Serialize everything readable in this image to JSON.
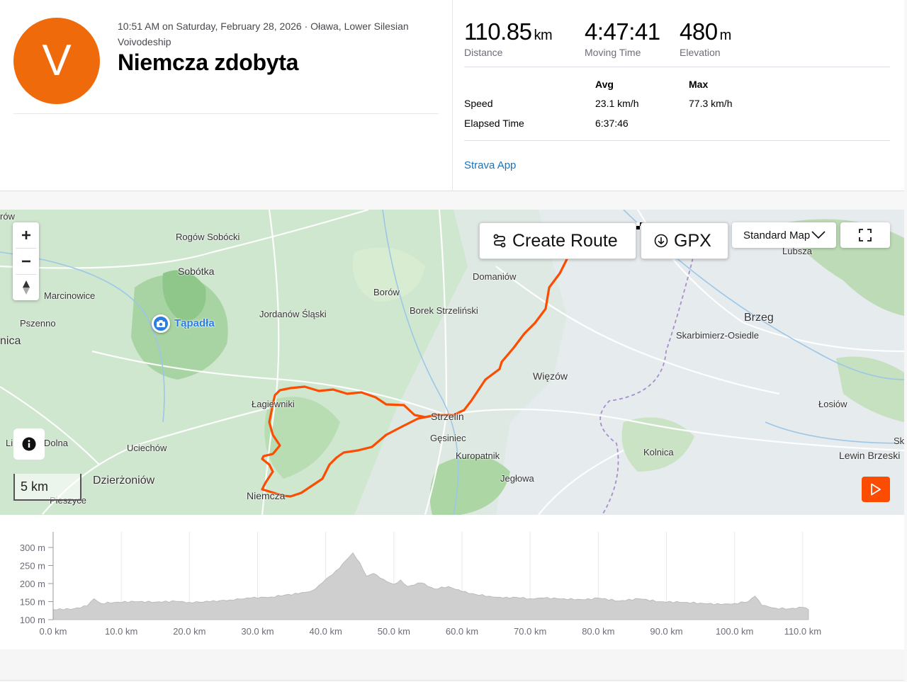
{
  "activity": {
    "avatar_letter": "V",
    "avatar_color": "#EF6A0B",
    "meta": "10:51 AM on Saturday, February 28, 2026 · Oława, Lower Silesian Voivodeship",
    "title": "Niemcza zdobyta"
  },
  "stats": {
    "distance": {
      "value": "110.85",
      "unit": "km",
      "label": "Distance"
    },
    "moving_time": {
      "value": "4:47:41",
      "label": "Moving Time"
    },
    "elevation": {
      "value": "480",
      "unit": "m",
      "label": "Elevation"
    }
  },
  "details": {
    "col_avg": "Avg",
    "col_max": "Max",
    "rows": [
      {
        "label": "Speed",
        "avg": "23.1 km/h",
        "max": "77.3 km/h"
      },
      {
        "label": "Elapsed Time",
        "avg": "6:37:46",
        "max": ""
      }
    ]
  },
  "device": "Strava App",
  "map": {
    "controls": {
      "create_route": "Create Route",
      "gpx": "GPX",
      "map_type": "Standard Map",
      "scale": "5 km",
      "photo_label": "Tąpadła"
    },
    "places": {
      "row": "rów",
      "rogow": "Rogów Sobócki",
      "sobotka": "Sobótka",
      "marcinowice": "Marcinowice",
      "pszenno": "Pszenno",
      "nica": "nica",
      "jordanow": "Jordanów Śląski",
      "borow": "Borów",
      "borek": "Borek Strzeliński",
      "domaniow": "Domaniów",
      "lubsza": "Lubsza",
      "brzeg": "Brzeg",
      "skarbimierz": "Skarbimierz-Osiedle",
      "wiezow": "Więzów",
      "lagiewniki": "Łagiewniki",
      "strzelin": "Strzelin",
      "gesiniec": "Gęsiniec",
      "kuropatnik": "Kuropatnik",
      "jeglowa": "Jegłowa",
      "kolnica": "Kolnica",
      "losiow": "Łosiów",
      "lewin": "Lewin Brzeski",
      "sk": "Sk",
      "li": "Li",
      "dolna": "Dolna",
      "uciechow": "Uciechów",
      "dzierzoniow": "Dzierżoniów",
      "pieszyce": "Pieszyce",
      "niemcza": "Niemcza"
    },
    "route_color": "#FC4C02",
    "accent_color": "#FC4C02"
  },
  "elevation_profile": {
    "y_ticks": [
      "300 m",
      "250 m",
      "200 m",
      "150 m",
      "100 m"
    ],
    "x_ticks": [
      "0.0 km",
      "10.0 km",
      "20.0 km",
      "30.0 km",
      "40.0 km",
      "50.0 km",
      "60.0 km",
      "70.0 km",
      "80.0 km",
      "90.0 km",
      "100.0 km",
      "110.0 km"
    ],
    "ylim": [
      100,
      300
    ],
    "xlim": [
      0,
      110.85
    ],
    "series_km": [
      0,
      3,
      5,
      6,
      7,
      9,
      12,
      15,
      18,
      20,
      23,
      26,
      29,
      32,
      34,
      36,
      38,
      39,
      40,
      41,
      42,
      43,
      44,
      45,
      46,
      47,
      48,
      49,
      50,
      51,
      52,
      54,
      56,
      58,
      60,
      62,
      64,
      66,
      68,
      70,
      72,
      75,
      78,
      80,
      83,
      86,
      89,
      92,
      95,
      98,
      100,
      102,
      103,
      104,
      106,
      108,
      110,
      110.85
    ],
    "series_m": [
      128,
      130,
      138,
      158,
      145,
      148,
      150,
      149,
      151,
      148,
      150,
      155,
      160,
      163,
      168,
      172,
      180,
      195,
      212,
      225,
      242,
      265,
      285,
      258,
      220,
      228,
      215,
      205,
      198,
      210,
      192,
      202,
      185,
      192,
      178,
      170,
      165,
      160,
      162,
      158,
      160,
      158,
      155,
      160,
      152,
      158,
      150,
      148,
      146,
      142,
      145,
      150,
      165,
      140,
      132,
      130,
      134,
      128
    ]
  }
}
